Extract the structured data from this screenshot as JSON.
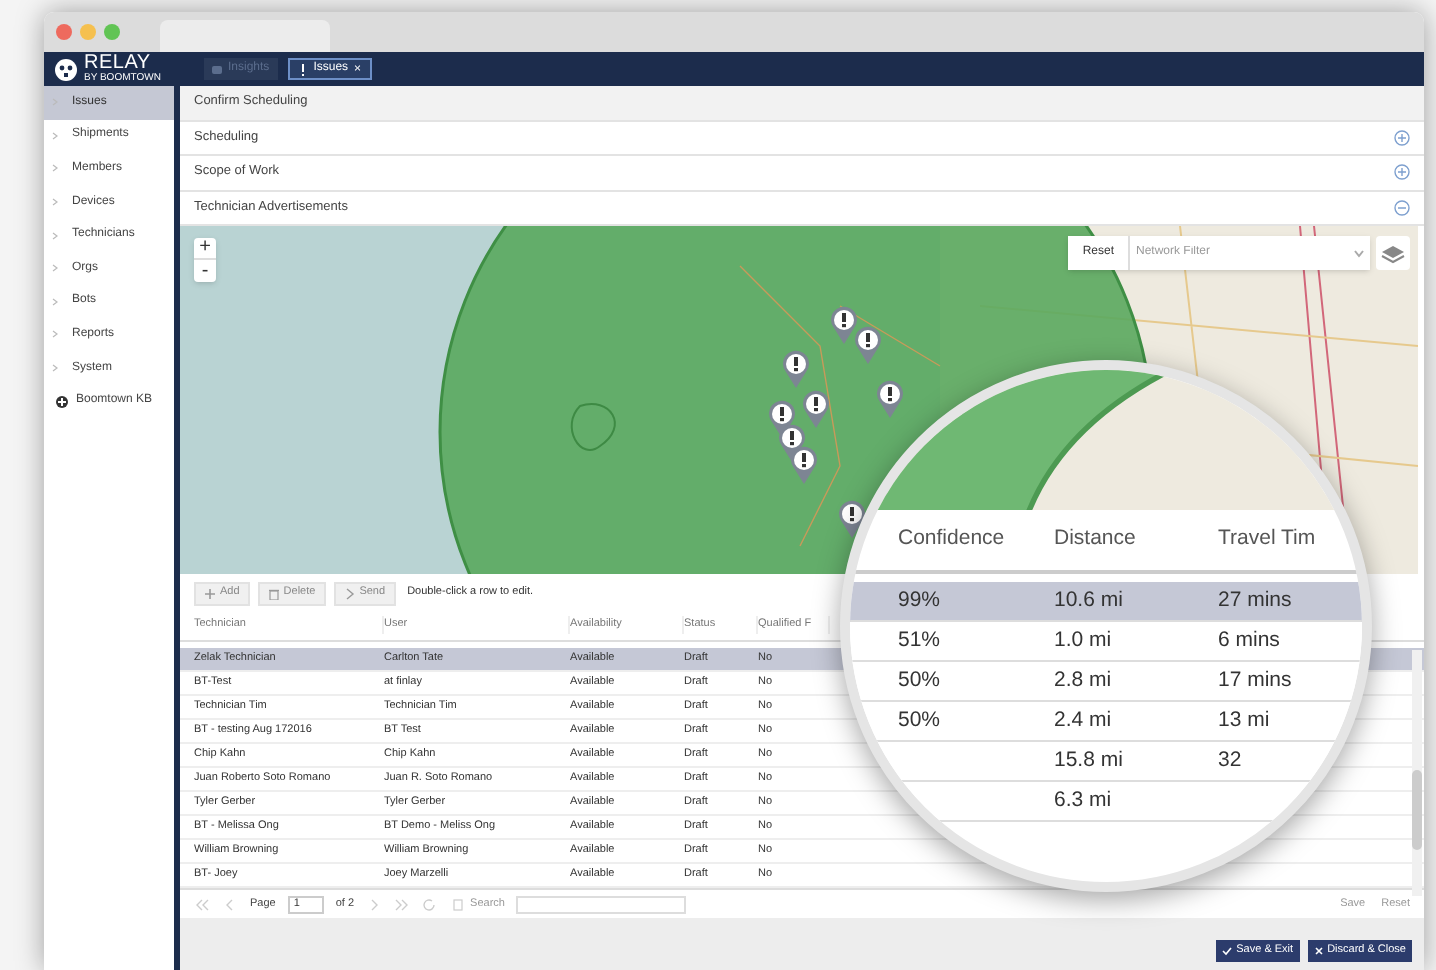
{
  "window": {
    "logo": {
      "name": "RELAY",
      "tagline": "BY BOOMTOWN"
    },
    "tabs": [
      {
        "label": "Insights",
        "selected": false
      },
      {
        "label": "Issues",
        "selected": true,
        "close": "×"
      }
    ]
  },
  "sidebar": {
    "items": [
      {
        "label": "Issues",
        "selected": true,
        "kind": "section"
      },
      {
        "label": "Shipments",
        "selected": false,
        "kind": "section"
      },
      {
        "label": "Members",
        "selected": false,
        "kind": "section"
      },
      {
        "label": "Devices",
        "selected": false,
        "kind": "section"
      },
      {
        "label": "Technicians",
        "selected": false,
        "kind": "section"
      },
      {
        "label": "Orgs",
        "selected": false,
        "kind": "section"
      },
      {
        "label": "Bots",
        "selected": false,
        "kind": "section"
      },
      {
        "label": "Reports",
        "selected": false,
        "kind": "section"
      },
      {
        "label": "System",
        "selected": false,
        "kind": "section"
      },
      {
        "label": "Boomtown KB",
        "selected": false,
        "kind": "link"
      }
    ]
  },
  "panels": [
    {
      "title": "Confirm Scheduling",
      "kind": "header"
    },
    {
      "title": "Scheduling",
      "kind": "panel",
      "expanded": false
    },
    {
      "title": "Scope of Work",
      "kind": "panel",
      "expanded": false
    },
    {
      "title": "Technician Advertisements",
      "kind": "panel",
      "expanded": true
    }
  ],
  "map": {
    "zoom_in": "+",
    "zoom_out": "-",
    "reset": "Reset",
    "filter": {
      "placeholder": "Network Filter"
    }
  },
  "toolbar": {
    "buttons": [
      {
        "label": "Add",
        "kind": "add"
      },
      {
        "label": "Delete",
        "kind": "delete"
      },
      {
        "label": "Send",
        "kind": "send"
      }
    ],
    "hint": "Double-click a row to edit."
  },
  "table": {
    "columns": [
      "Technician",
      "User",
      "Availability",
      "Status",
      "Qualified F"
    ],
    "rows": [
      {
        "cells": [
          "Zelak Technician",
          "Carlton Tate",
          "Available",
          "Draft",
          "No"
        ],
        "selected": true
      },
      {
        "cells": [
          "BT-Test",
          "at finlay",
          "Available",
          "Draft",
          "No"
        ],
        "selected": false
      },
      {
        "cells": [
          "Technician Tim",
          "Technician Tim",
          "Available",
          "Draft",
          "No"
        ],
        "selected": false
      },
      {
        "cells": [
          "BT - testing Aug 172016",
          "BT Test",
          "Available",
          "Draft",
          "No"
        ],
        "selected": false
      },
      {
        "cells": [
          "Chip Kahn",
          "Chip Kahn",
          "Available",
          "Draft",
          "No"
        ],
        "selected": false
      },
      {
        "cells": [
          "Juan Roberto Soto Romano",
          "Juan R. Soto Romano",
          "Available",
          "Draft",
          "No"
        ],
        "selected": false
      },
      {
        "cells": [
          "Tyler Gerber",
          "Tyler Gerber",
          "Available",
          "Draft",
          "No"
        ],
        "selected": false
      },
      {
        "cells": [
          "BT - Melissa Ong",
          "BT Demo - Meliss Ong",
          "Available",
          "Draft",
          "No"
        ],
        "selected": false
      },
      {
        "cells": [
          "William Browning",
          "William Browning",
          "Available",
          "Draft",
          "No"
        ],
        "selected": false
      },
      {
        "cells": [
          "BT- Joey",
          "Joey Marzelli",
          "Available",
          "Draft",
          "No"
        ],
        "selected": false
      }
    ]
  },
  "pager": {
    "page_label": "Page",
    "page": "1",
    "of": "of 2",
    "search": "Search"
  },
  "table_actions": [
    "Save",
    "Reset"
  ],
  "footer": {
    "buttons": [
      {
        "label": "Save & Exit",
        "kind": "save"
      },
      {
        "label": "Discard & Close",
        "kind": "discard"
      }
    ]
  },
  "magnifier": {
    "columns": [
      "Confidence",
      "Distance",
      "Travel Tim"
    ],
    "rows": [
      {
        "cells": [
          "99%",
          "10.6 mi",
          "27 mins"
        ],
        "selected": true
      },
      {
        "cells": [
          "51%",
          "1.0 mi",
          "6 mins"
        ],
        "selected": false
      },
      {
        "cells": [
          "50%",
          "2.8 mi",
          "17 mins"
        ],
        "selected": false
      },
      {
        "cells": [
          "50%",
          "2.4 mi",
          "13 mi"
        ],
        "selected": false
      },
      {
        "cells": [
          "",
          "15.8 mi",
          "32"
        ],
        "selected": false
      },
      {
        "cells": [
          "",
          "6.3 mi",
          ""
        ],
        "selected": false
      }
    ]
  }
}
